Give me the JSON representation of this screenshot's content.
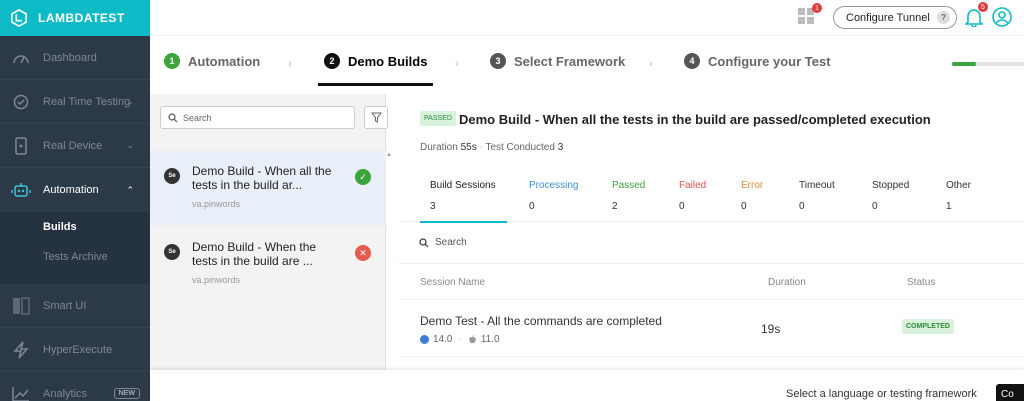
{
  "brand": {
    "name": "LAMBDATEST"
  },
  "sidebar": {
    "items": [
      {
        "label": "Dashboard"
      },
      {
        "label": "Real Time Testing"
      },
      {
        "label": "Real Device"
      },
      {
        "label": "Automation"
      },
      {
        "label": "Smart UI"
      },
      {
        "label": "HyperExecute"
      },
      {
        "label": "Analytics",
        "badge": "NEW"
      }
    ],
    "sub_items": [
      {
        "label": "Builds"
      },
      {
        "label": "Tests Archive"
      }
    ]
  },
  "header": {
    "grid_badge": "1",
    "tunnel_label": "Configure Tunnel",
    "tunnel_help": "?",
    "bell_badge": "5"
  },
  "stepper": {
    "steps": [
      {
        "num": "1",
        "label": "Automation"
      },
      {
        "num": "2",
        "label": "Demo Builds"
      },
      {
        "num": "3",
        "label": "Select Framework"
      },
      {
        "num": "4",
        "label": "Configure your Test"
      }
    ],
    "progress": 0.3
  },
  "list": {
    "search_placeholder": "Search",
    "builds": [
      {
        "icon_text": "Se",
        "title": "Demo Build - When all the tests in the build ar...",
        "user": "va.pinwords",
        "status": "passed"
      },
      {
        "icon_text": "Se",
        "title": "Demo Build - When the tests in the build are ...",
        "user": "va.pinwords",
        "status": "failed"
      }
    ]
  },
  "detail": {
    "badge": "PASSED",
    "title": "Demo Build - When all the tests in the build are passed/completed execution",
    "duration_label": "Duration",
    "duration": "55s",
    "tests_label": "Test Conducted",
    "tests": "3",
    "tabs": [
      {
        "label": "Build Sessions",
        "value": "3",
        "color": "#222222"
      },
      {
        "label": "Processing",
        "value": "0",
        "color": "#3a8fd9"
      },
      {
        "label": "Passed",
        "value": "2",
        "color": "#3ba43b"
      },
      {
        "label": "Failed",
        "value": "0",
        "color": "#e05050"
      },
      {
        "label": "Error",
        "value": "0",
        "color": "#e08a3a"
      },
      {
        "label": "Timeout",
        "value": "0",
        "color": "#333333"
      },
      {
        "label": "Stopped",
        "value": "0",
        "color": "#333333"
      },
      {
        "label": "Other",
        "value": "1",
        "color": "#333333"
      }
    ],
    "session_search": "Search",
    "columns": {
      "name": "Session Name",
      "duration": "Duration",
      "status": "Status"
    },
    "sessions": [
      {
        "name": "Demo Test - All the commands are completed",
        "browser_version": "14.0",
        "os_version": "11.0",
        "duration": "19s",
        "status": "COMPLETED"
      }
    ]
  },
  "bottom": {
    "text": "Select a language or testing framework",
    "button": "Co"
  }
}
